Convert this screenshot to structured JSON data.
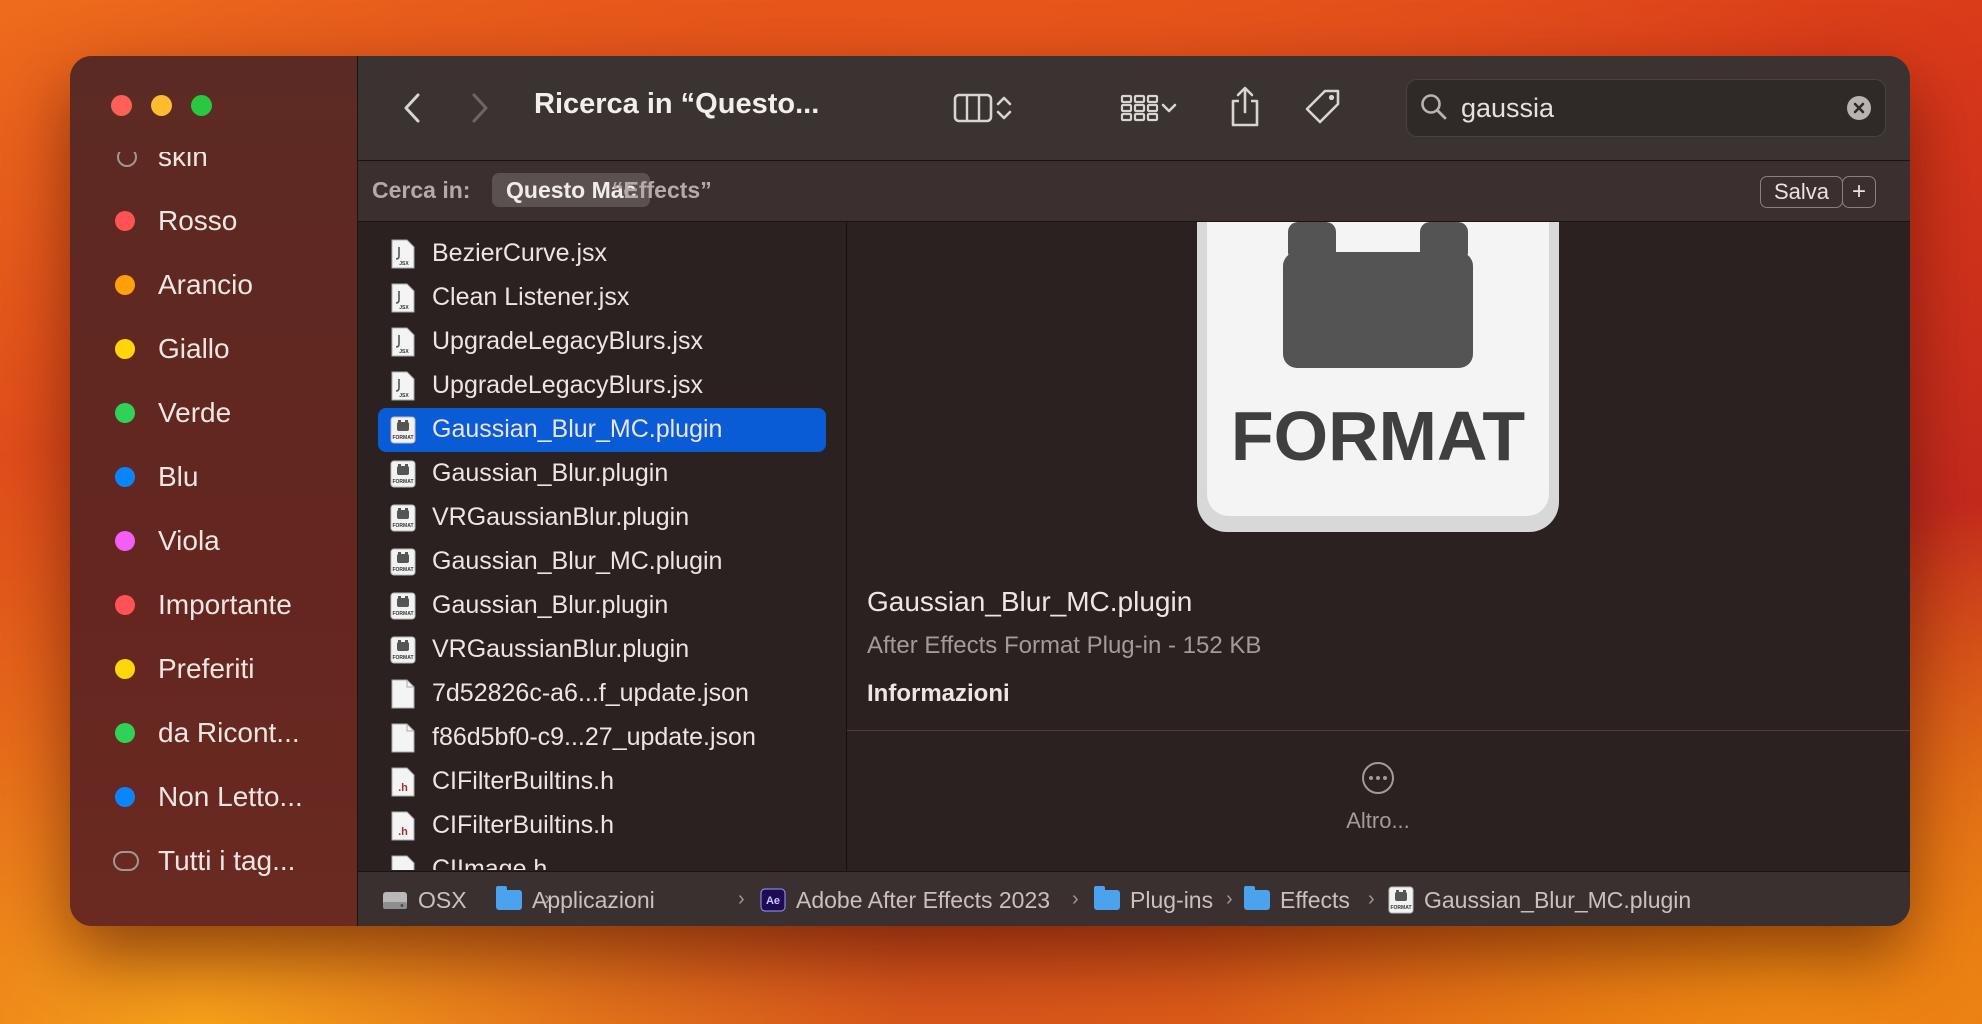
{
  "sidebar": {
    "tags": [
      {
        "label": "skin",
        "color": "ring"
      },
      {
        "label": "Rosso",
        "color": "#ff5257"
      },
      {
        "label": "Arancio",
        "color": "#ff9f0a"
      },
      {
        "label": "Giallo",
        "color": "#ffd60a"
      },
      {
        "label": "Verde",
        "color": "#30d158"
      },
      {
        "label": "Blu",
        "color": "#0a84ff"
      },
      {
        "label": "Viola",
        "color": "#f25ef7"
      },
      {
        "label": "Importante",
        "color": "#ff5257"
      },
      {
        "label": "Preferiti",
        "color": "#ffd60a"
      },
      {
        "label": "da Ricont...",
        "color": "#30d158"
      },
      {
        "label": "Non Letto...",
        "color": "#0a84ff"
      },
      {
        "label": "Tutti i tag...",
        "color": "multi"
      }
    ]
  },
  "toolbar": {
    "title": "Ricerca in “Questo...",
    "search_value": "gaussia"
  },
  "scope": {
    "label": "Cerca in:",
    "active": "Questo Mac",
    "inactive": "“Effects”",
    "save_label": "Salva",
    "add_label": "+"
  },
  "files": [
    {
      "name": "BezierCurve.jsx",
      "icon": "jsx-file-icon"
    },
    {
      "name": "Clean Listener.jsx",
      "icon": "jsx-file-icon"
    },
    {
      "name": "UpgradeLegacyBlurs.jsx",
      "icon": "jsx-file-icon"
    },
    {
      "name": "UpgradeLegacyBlurs.jsx",
      "icon": "jsx-file-icon"
    },
    {
      "name": "Gaussian_Blur_MC.plugin",
      "icon": "plugin-file-icon",
      "selected": true
    },
    {
      "name": "Gaussian_Blur.plugin",
      "icon": "plugin-file-icon"
    },
    {
      "name": "VRGaussianBlur.plugin",
      "icon": "plugin-file-icon"
    },
    {
      "name": "Gaussian_Blur_MC.plugin",
      "icon": "plugin-file-icon"
    },
    {
      "name": "Gaussian_Blur.plugin",
      "icon": "plugin-file-icon"
    },
    {
      "name": "VRGaussianBlur.plugin",
      "icon": "plugin-file-icon"
    },
    {
      "name": "7d52826c-a6...f_update.json",
      "icon": "json-file-icon"
    },
    {
      "name": "f86d5bf0-c9...27_update.json",
      "icon": "json-file-icon"
    },
    {
      "name": "CIFilterBuiltins.h",
      "icon": "header-file-icon"
    },
    {
      "name": "CIFilterBuiltins.h",
      "icon": "header-file-icon"
    },
    {
      "name": "CIImage.h",
      "icon": "header-file-icon"
    }
  ],
  "preview": {
    "icon_text": "FORMAT",
    "name": "Gaussian_Blur_MC.plugin",
    "kind": "After Effects Format Plug-in - 152 KB",
    "info_heading": "Informazioni",
    "more_label": "Altro..."
  },
  "icon_mini_text": {
    "jsx": "JSX",
    "plugin": "FORMAT",
    "header": ".h"
  },
  "pathbar": {
    "crumbs": [
      {
        "label": "OSX",
        "icon": "disk-icon"
      },
      {
        "label": "Applicazioni",
        "icon": "folder-icon"
      },
      {
        "label": "Adobe After Effects 2023",
        "icon": "ae-app-icon",
        "icon_text": "Ae"
      },
      {
        "label": "Plug-ins",
        "icon": "folder-icon"
      },
      {
        "label": "Effects",
        "icon": "folder-icon"
      },
      {
        "label": "Gaussian_Blur_MC.plugin",
        "icon": "plugin-file-icon"
      }
    ],
    "separator": "›"
  }
}
